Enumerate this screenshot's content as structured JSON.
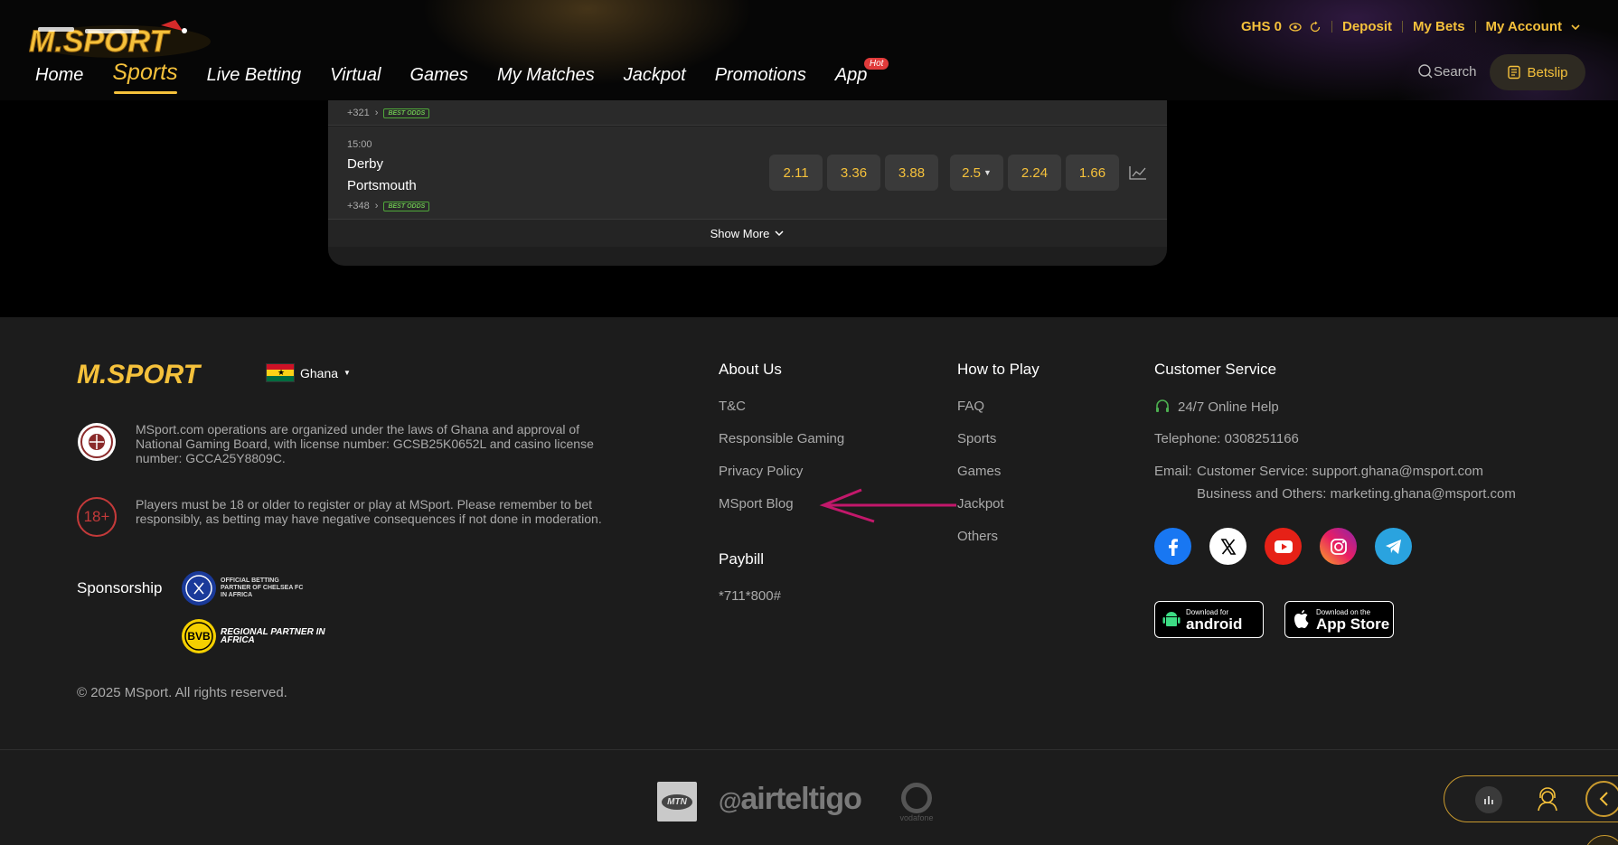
{
  "brand": {
    "name": "M.SPORT"
  },
  "nav": {
    "items": [
      {
        "label": "Home"
      },
      {
        "label": "Sports"
      },
      {
        "label": "Live Betting"
      },
      {
        "label": "Virtual"
      },
      {
        "label": "Games"
      },
      {
        "label": "My Matches"
      },
      {
        "label": "Jackpot"
      },
      {
        "label": "Promotions"
      },
      {
        "label": "App"
      }
    ],
    "active": "Sports",
    "app_badge": "Hot"
  },
  "account": {
    "balance": "GHS 0",
    "deposit": "Deposit",
    "my_bets": "My Bets",
    "my_account": "My Account",
    "search": "Search",
    "betslip": "Betslip"
  },
  "matches": [
    {
      "markets_count": "+321",
      "badge": "BEST ODDS"
    },
    {
      "time": "15:00",
      "home": "Derby",
      "away": "Portsmouth",
      "markets_count": "+348",
      "badge": "BEST ODDS",
      "odds": [
        "2.11",
        "3.36",
        "3.88"
      ],
      "total_line": "2.5",
      "ou_odds": [
        "2.24",
        "1.66"
      ]
    }
  ],
  "show_more": "Show More",
  "footer": {
    "country": "Ghana",
    "license_text": "MSport.com operations are organized under the laws of Ghana and approval of National Gaming Board, with license number: GCSB25K0652L and casino license number: GCCA25Y8809C.",
    "age_badge": "18+",
    "age_text": "Players must be 18 or older to register or play at MSport. Please remember to bet responsibly, as betting may have negative consequences if not done in moderation.",
    "sponsorship_label": "Sponsorship",
    "sponsor1_text": "OFFICIAL BETTING PARTNER OF CHELSEA FC IN AFRICA",
    "sponsor2_text": "REGIONAL PARTNER IN AFRICA",
    "copyright": "© 2025 MSport. All rights reserved.",
    "about": {
      "title": "About Us",
      "links": [
        "T&C",
        "Responsible Gaming",
        "Privacy Policy",
        "MSport Blog"
      ]
    },
    "paybill": {
      "title": "Paybill",
      "code": "*711*800#"
    },
    "how_to_play": {
      "title": "How to Play",
      "links": [
        "FAQ",
        "Sports",
        "Games",
        "Jackpot",
        "Others"
      ]
    },
    "customer_service": {
      "title": "Customer Service",
      "online_help": "24/7 Online Help",
      "telephone": "Telephone: 0308251166",
      "email_label": "Email:",
      "email_cs": "Customer Service: support.ghana@msport.com",
      "email_business": "Business and Others: marketing.ghana@msport.com"
    },
    "socials": [
      "facebook-icon",
      "x-icon",
      "youtube-icon",
      "instagram-icon",
      "telegram-icon"
    ],
    "android": {
      "small": "Download for",
      "big": "android"
    },
    "appstore": {
      "small": "Download on the",
      "big": "App Store"
    }
  },
  "payments": {
    "mtn": "MTN",
    "airteltigo": "airteltigo",
    "vodafone": "vodafone"
  },
  "colors": {
    "accent": "#f5c13b",
    "background": "#000000",
    "footer_bg": "#1c1c1c",
    "best_odds_green": "#6bc04f",
    "annotation_arrow": "#c2186b"
  }
}
